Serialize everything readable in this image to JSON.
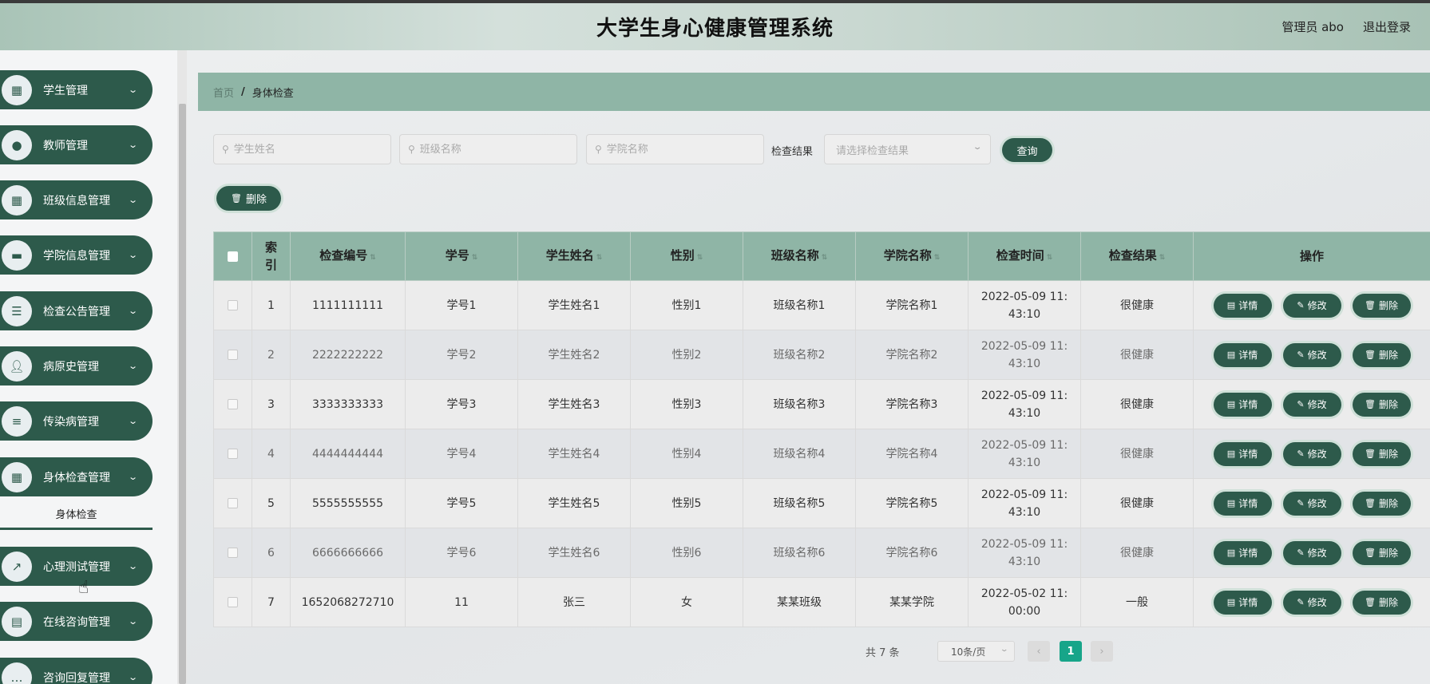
{
  "header": {
    "title": "大学生身心健康管理系统",
    "user_label": "管理员 abo",
    "logout_label": "退出登录"
  },
  "sidebar": {
    "items": [
      {
        "label": "学生管理",
        "icon": "grid-icon"
      },
      {
        "label": "教师管理",
        "icon": "pin-icon"
      },
      {
        "label": "班级信息管理",
        "icon": "grid-icon"
      },
      {
        "label": "学院信息管理",
        "icon": "briefcase-icon"
      },
      {
        "label": "检查公告管理",
        "icon": "sliders-icon"
      },
      {
        "label": "病原史管理",
        "icon": "user-icon"
      },
      {
        "label": "传染病管理",
        "icon": "list-icon"
      },
      {
        "label": "身体检查管理",
        "icon": "grid-icon"
      },
      {
        "label": "心理测试管理",
        "icon": "chart-icon"
      },
      {
        "label": "在线咨询管理",
        "icon": "clipboard-icon"
      },
      {
        "label": "咨询回复管理",
        "icon": "chat-icon"
      }
    ],
    "submenu_active": "身体检查"
  },
  "breadcrumb": {
    "home": "首页",
    "separator": "/",
    "current": "身体检查"
  },
  "search": {
    "student_name_placeholder": "学生姓名",
    "class_name_placeholder": "班级名称",
    "college_name_placeholder": "学院名称",
    "result_label": "检查结果",
    "result_placeholder": "请选择检查结果",
    "query_label": "查询"
  },
  "toolbar": {
    "delete_label": "删除"
  },
  "table": {
    "headers": [
      "索引",
      "检查编号",
      "学号",
      "学生姓名",
      "性别",
      "班级名称",
      "学院名称",
      "检查时间",
      "检查结果",
      "操作"
    ],
    "actions": {
      "detail": "详情",
      "edit": "修改",
      "delete": "删除"
    },
    "rows": [
      {
        "index": "1",
        "code": "1111111111",
        "student_no": "学号1",
        "student_name": "学生姓名1",
        "gender": "性别1",
        "class_name": "班级名称1",
        "college": "学院名称1",
        "time_a": "2022-05-09 11:",
        "time_b": "43:10",
        "result": "很健康"
      },
      {
        "index": "2",
        "code": "2222222222",
        "student_no": "学号2",
        "student_name": "学生姓名2",
        "gender": "性别2",
        "class_name": "班级名称2",
        "college": "学院名称2",
        "time_a": "2022-05-09 11:",
        "time_b": "43:10",
        "result": "很健康"
      },
      {
        "index": "3",
        "code": "3333333333",
        "student_no": "学号3",
        "student_name": "学生姓名3",
        "gender": "性别3",
        "class_name": "班级名称3",
        "college": "学院名称3",
        "time_a": "2022-05-09 11:",
        "time_b": "43:10",
        "result": "很健康"
      },
      {
        "index": "4",
        "code": "4444444444",
        "student_no": "学号4",
        "student_name": "学生姓名4",
        "gender": "性别4",
        "class_name": "班级名称4",
        "college": "学院名称4",
        "time_a": "2022-05-09 11:",
        "time_b": "43:10",
        "result": "很健康"
      },
      {
        "index": "5",
        "code": "5555555555",
        "student_no": "学号5",
        "student_name": "学生姓名5",
        "gender": "性别5",
        "class_name": "班级名称5",
        "college": "学院名称5",
        "time_a": "2022-05-09 11:",
        "time_b": "43:10",
        "result": "很健康"
      },
      {
        "index": "6",
        "code": "6666666666",
        "student_no": "学号6",
        "student_name": "学生姓名6",
        "gender": "性别6",
        "class_name": "班级名称6",
        "college": "学院名称6",
        "time_a": "2022-05-09 11:",
        "time_b": "43:10",
        "result": "很健康"
      },
      {
        "index": "7",
        "code": "1652068272710",
        "student_no": "11",
        "student_name": "张三",
        "gender": "女",
        "class_name": "某某班级",
        "college": "某某学院",
        "time_a": "2022-05-02 11:",
        "time_b": "00:00",
        "result": "一般"
      }
    ]
  },
  "pagination": {
    "total_label": "共 7 条",
    "page_size": "10条/页",
    "current_page": "1"
  },
  "colors": {
    "primary": "#2d5a4b",
    "header_bg": "#8fb5a6",
    "active_page": "#17a589"
  }
}
